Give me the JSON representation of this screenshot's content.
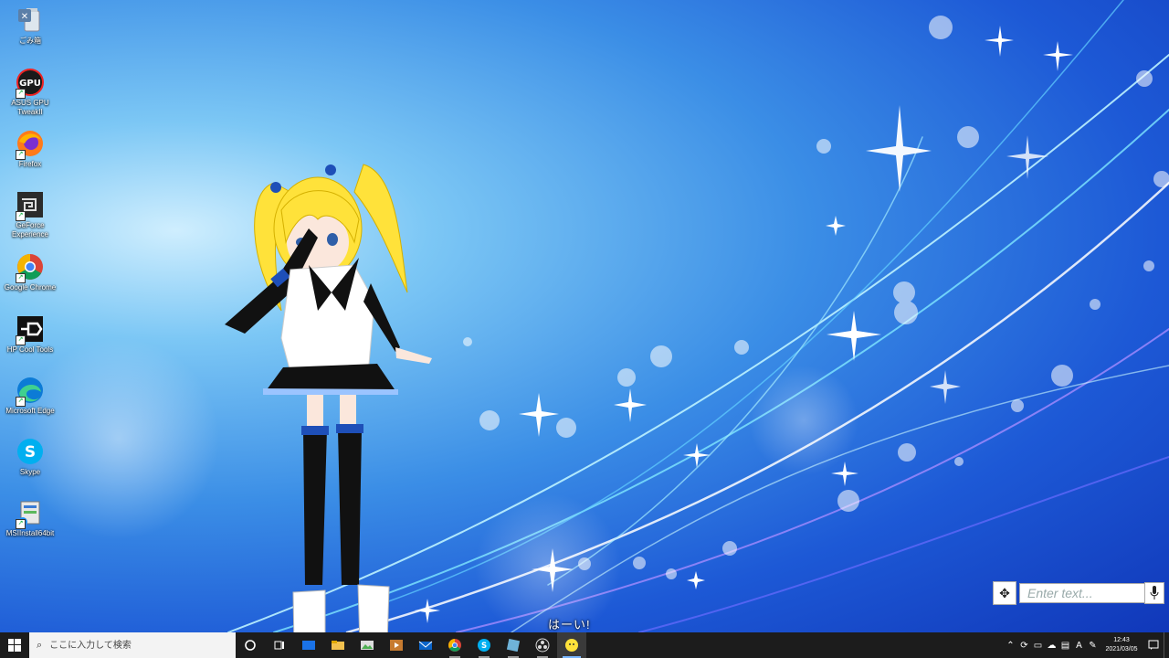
{
  "desktop": {
    "icons": [
      {
        "label": "ごみ箱",
        "icon": "recycle-bin-icon"
      },
      {
        "label": "ASUS GPU TweakII",
        "icon": "gpu-tweak-icon"
      },
      {
        "label": "Firefox",
        "icon": "firefox-icon"
      },
      {
        "label": "GeForce Experience",
        "icon": "geforce-icon"
      },
      {
        "label": "Google Chrome",
        "icon": "chrome-icon"
      },
      {
        "label": "HP Cool Tools",
        "icon": "hp-cool-tools-icon"
      },
      {
        "label": "Microsoft Edge",
        "icon": "edge-icon"
      },
      {
        "label": "Skype",
        "icon": "skype-icon"
      },
      {
        "label": "MSIInstall64bit",
        "icon": "installer-icon"
      }
    ]
  },
  "character": {
    "subtitle": "はーい!"
  },
  "chat": {
    "placeholder": "Enter text..."
  },
  "taskbar": {
    "search_placeholder": "ここに入力して検索",
    "apps": [
      "cortana-icon",
      "task-view-icon",
      "mail-app-icon",
      "file-explorer-icon",
      "photos-icon",
      "media-player-icon",
      "mail-icon",
      "chrome-icon",
      "skype-icon",
      "app-icon",
      "obs-icon",
      "mascot-app-icon"
    ],
    "clock_time": "12:43",
    "clock_date": "2021/03/05",
    "ime_mode": "A"
  }
}
